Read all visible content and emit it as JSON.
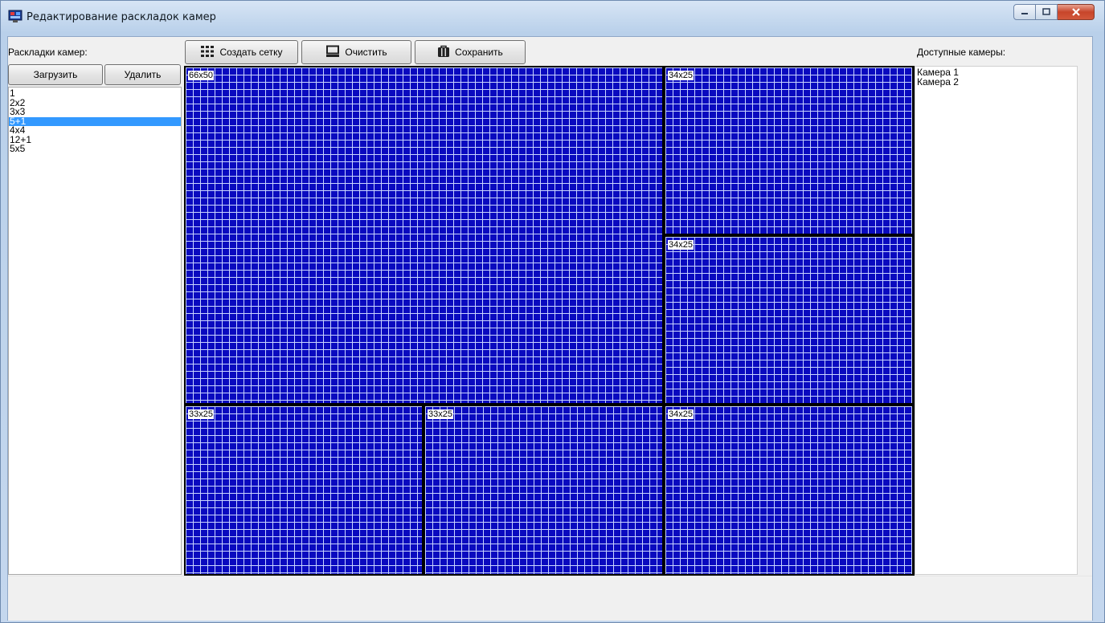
{
  "window": {
    "title": "Редактирование раскладок камер"
  },
  "layouts_panel": {
    "label": "Раскладки камер:",
    "load_label": "Загрузить",
    "delete_label": "Удалить",
    "items": [
      "1",
      "2x2",
      "3x3",
      "5+1",
      "4x4",
      "12+1",
      "5x5"
    ],
    "selected": "5+1"
  },
  "toolbar": {
    "create_grid_label": "Создать сетку",
    "clear_label": "Очистить",
    "save_label": "Сохранить"
  },
  "grid": {
    "cells": [
      {
        "label": "66x50"
      },
      {
        "label": "34x25"
      },
      {
        "label": "34x25"
      },
      {
        "label": "33x25"
      },
      {
        "label": "33x25"
      },
      {
        "label": "34x25"
      }
    ]
  },
  "cameras_panel": {
    "label": "Доступные камеры:",
    "items": [
      "Камера 1",
      "Камера 2"
    ]
  },
  "colors": {
    "cell_fill": "#0a0abf",
    "grid_lines": "#c8d4ff",
    "selection": "#3399ff"
  },
  "icons": {
    "app": "camera-layout-app-icon",
    "create_grid": "grid-dots-icon",
    "clear": "monitor-icon",
    "save": "briefcase-icon"
  }
}
